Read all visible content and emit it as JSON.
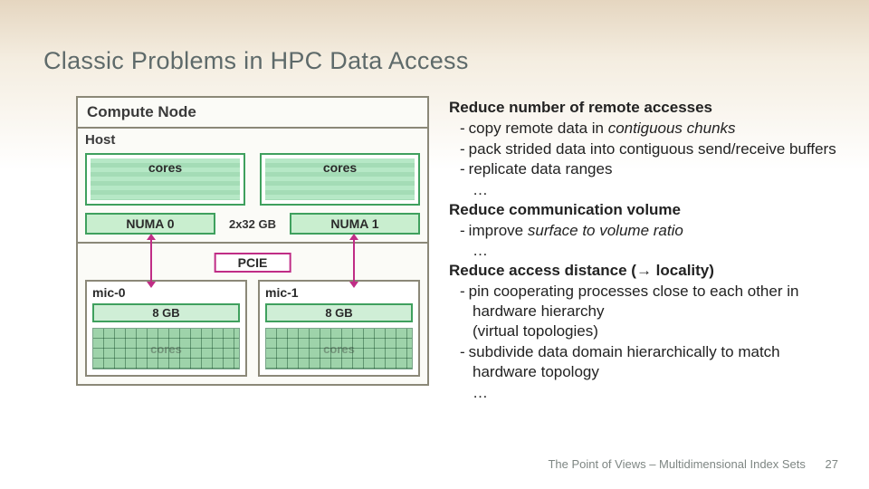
{
  "title": "Classic Problems in HPC Data Access",
  "diagram": {
    "compute": "Compute Node",
    "host": "Host",
    "cores": "cores",
    "numa0": "NUMA 0",
    "numa1": "NUMA 1",
    "mem": "2x32 GB",
    "pcie": "PCIE",
    "mic0": "mic-0",
    "mic1": "mic-1",
    "gb": "8 GB",
    "mic_cores": "cores"
  },
  "text": {
    "h1": "Reduce number of remote accesses",
    "h1_b1_pre": "copy remote data in ",
    "h1_b1_em": "contiguous chunks",
    "h1_b2": "pack strided data into contiguous send/receive buffers",
    "h1_b3": "replicate data ranges",
    "h2": "Reduce communication volume",
    "h2_b1_pre": "improve ",
    "h2_b1_em": "surface to volume ratio",
    "h3_pre": "Reduce access distance (",
    "h3_arrow": "→",
    "h3_post": " locality)",
    "h3_b1": "pin cooperating processes close to each other in hardware hierarchy",
    "h3_b1_sub": "(virtual topologies)",
    "h3_b2": "subdivide data domain hierarchically to match hardware topology",
    "ellipsis": "…",
    "dash": "-"
  },
  "footer": {
    "text": "The Point of Views – Multidimensional Index Sets",
    "page": "27"
  }
}
